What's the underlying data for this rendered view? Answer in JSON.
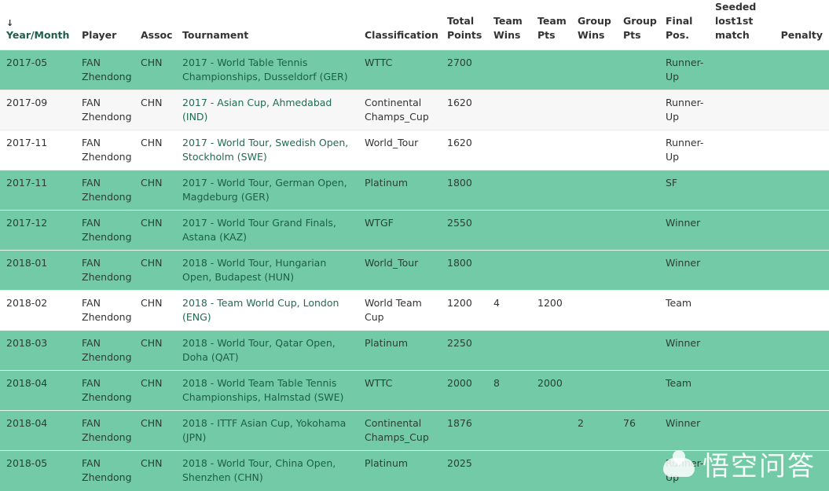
{
  "table": {
    "sort_indicator": "↓",
    "headers": {
      "year_month": "Year/Month",
      "player": "Player",
      "assoc": "Assoc",
      "tournament": "Tournament",
      "classification": "Classification",
      "total_points": "Total Points",
      "team_wins": "Team Wins",
      "team_pts": "Team Pts",
      "group_wins": "Group Wins",
      "group_pts": "Group Pts",
      "final_pos": "Final Pos.",
      "seeded_lost": "Seeded lost1st match",
      "penalty": "Penalty"
    },
    "rows": [
      {
        "year_month": "2017-05",
        "player": "FAN Zhendong",
        "assoc": "CHN",
        "tournament": "2017 - World Table Tennis Championships, Dusseldorf (GER)",
        "classification": "WTTC",
        "total_points": "2700",
        "team_wins": "",
        "team_pts": "",
        "group_wins": "",
        "group_pts": "",
        "final_pos": "Runner-Up",
        "seeded_lost": "",
        "penalty": "",
        "style": "hl"
      },
      {
        "year_month": "2017-09",
        "player": "FAN Zhendong",
        "assoc": "CHN",
        "tournament": "2017 - Asian Cup, Ahmedabad (IND)",
        "classification": "Continental Champs_Cup",
        "total_points": "1620",
        "team_wins": "",
        "team_pts": "",
        "group_wins": "",
        "group_pts": "",
        "final_pos": "Runner-Up",
        "seeded_lost": "",
        "penalty": "",
        "style": "alt"
      },
      {
        "year_month": "2017-11",
        "player": "FAN Zhendong",
        "assoc": "CHN",
        "tournament": "2017 - World Tour, Swedish Open, Stockholm (SWE)",
        "classification": "World_Tour",
        "total_points": "1620",
        "team_wins": "",
        "team_pts": "",
        "group_wins": "",
        "group_pts": "",
        "final_pos": "Runner-Up",
        "seeded_lost": "",
        "penalty": "",
        "style": "plain"
      },
      {
        "year_month": "2017-11",
        "player": "FAN Zhendong",
        "assoc": "CHN",
        "tournament": "2017 - World Tour, German Open, Magdeburg (GER)",
        "classification": "Platinum",
        "total_points": "1800",
        "team_wins": "",
        "team_pts": "",
        "group_wins": "",
        "group_pts": "",
        "final_pos": "SF",
        "seeded_lost": "",
        "penalty": "",
        "style": "hl"
      },
      {
        "year_month": "2017-12",
        "player": "FAN Zhendong",
        "assoc": "CHN",
        "tournament": "2017 - World Tour Grand Finals, Astana (KAZ)",
        "classification": "WTGF",
        "total_points": "2550",
        "team_wins": "",
        "team_pts": "",
        "group_wins": "",
        "group_pts": "",
        "final_pos": "Winner",
        "seeded_lost": "",
        "penalty": "",
        "style": "hl"
      },
      {
        "year_month": "2018-01",
        "player": "FAN Zhendong",
        "assoc": "CHN",
        "tournament": "2018 - World Tour, Hungarian Open, Budapest (HUN)",
        "classification": "World_Tour",
        "total_points": "1800",
        "team_wins": "",
        "team_pts": "",
        "group_wins": "",
        "group_pts": "",
        "final_pos": "Winner",
        "seeded_lost": "",
        "penalty": "",
        "style": "hl"
      },
      {
        "year_month": "2018-02",
        "player": "FAN Zhendong",
        "assoc": "CHN",
        "tournament": "2018 - Team World Cup, London (ENG)",
        "classification": "World Team Cup",
        "total_points": "1200",
        "team_wins": "4",
        "team_pts": "1200",
        "group_wins": "",
        "group_pts": "",
        "final_pos": "Team",
        "seeded_lost": "",
        "penalty": "",
        "style": "plain"
      },
      {
        "year_month": "2018-03",
        "player": "FAN Zhendong",
        "assoc": "CHN",
        "tournament": "2018 - World Tour, Qatar Open, Doha (QAT)",
        "classification": "Platinum",
        "total_points": "2250",
        "team_wins": "",
        "team_pts": "",
        "group_wins": "",
        "group_pts": "",
        "final_pos": "Winner",
        "seeded_lost": "",
        "penalty": "",
        "style": "hl"
      },
      {
        "year_month": "2018-04",
        "player": "FAN Zhendong",
        "assoc": "CHN",
        "tournament": "2018 - World Team Table Tennis Championships, Halmstad (SWE)",
        "classification": "WTTC",
        "total_points": "2000",
        "team_wins": "8",
        "team_pts": "2000",
        "group_wins": "",
        "group_pts": "",
        "final_pos": "Team",
        "seeded_lost": "",
        "penalty": "",
        "style": "hl"
      },
      {
        "year_month": "2018-04",
        "player": "FAN Zhendong",
        "assoc": "CHN",
        "tournament": "2018 - ITTF Asian Cup, Yokohama (JPN)",
        "classification": "Continental Champs_Cup",
        "total_points": "1876",
        "team_wins": "",
        "team_pts": "",
        "group_wins": "2",
        "group_pts": "76",
        "final_pos": "Winner",
        "seeded_lost": "",
        "penalty": "",
        "style": "hl"
      },
      {
        "year_month": "2018-05",
        "player": "FAN Zhendong",
        "assoc": "CHN",
        "tournament": "2018 - World Tour, China Open, Shenzhen (CHN)",
        "classification": "Platinum",
        "total_points": "2025",
        "team_wins": "",
        "team_pts": "",
        "group_wins": "",
        "group_pts": "",
        "final_pos": "Runner-Up",
        "seeded_lost": "",
        "penalty": "",
        "style": "hl"
      }
    ]
  },
  "watermark": {
    "text": "悟空问答"
  },
  "colors": {
    "highlight_row": "#72cba6",
    "header_sorted": "#1f5e4b",
    "tournament_link": "#1f6b54"
  }
}
